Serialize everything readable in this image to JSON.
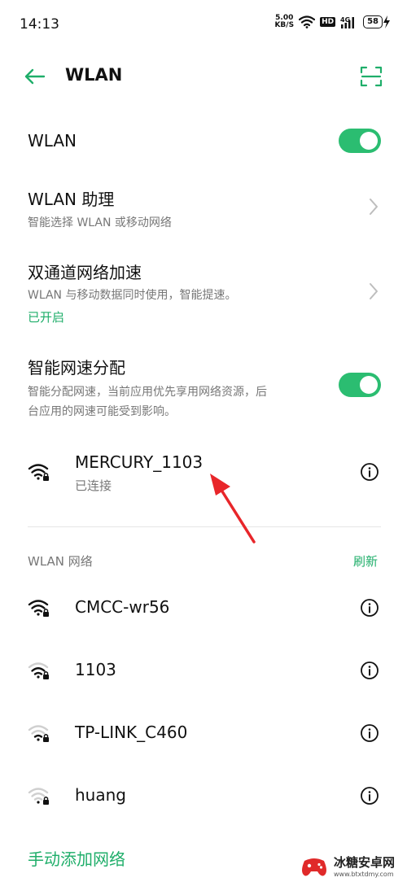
{
  "status_bar": {
    "time": "14:13",
    "net_speed_value": "5.00",
    "net_speed_unit": "KB/S",
    "hd_label": "HD",
    "cellular_label": "4G",
    "battery": "58"
  },
  "header": {
    "title": "WLAN"
  },
  "settings": {
    "wlan": {
      "label": "WLAN",
      "enabled": true
    },
    "assistant": {
      "title": "WLAN 助理",
      "subtitle": "智能选择 WLAN 或移动网络"
    },
    "dual_channel": {
      "title": "双通道网络加速",
      "subtitle": "WLAN 与移动数据同时使用，智能提速。",
      "status": "已开启"
    },
    "smart_speed": {
      "title": "智能网速分配",
      "subtitle_line1": "智能分配网速，当前应用优先享用网络资源，后",
      "subtitle_line2": "台应用的网速可能受到影响。",
      "enabled": true
    }
  },
  "connected": {
    "name": "MERCURY_1103",
    "status": "已连接"
  },
  "networks_section": {
    "label": "WLAN 网络",
    "refresh": "刷新",
    "items": [
      {
        "name": "CMCC-wr56"
      },
      {
        "name": "1103"
      },
      {
        "name": "TP-LINK_C460"
      },
      {
        "name": "huang"
      }
    ]
  },
  "add_network": "手动添加网络",
  "watermark": {
    "name": "冰糖安卓网",
    "url": "www.btxtdmy.com"
  },
  "colors": {
    "accent": "#1fae6a",
    "toggle_on": "#2bbd71",
    "annotation": "#e8262a"
  }
}
